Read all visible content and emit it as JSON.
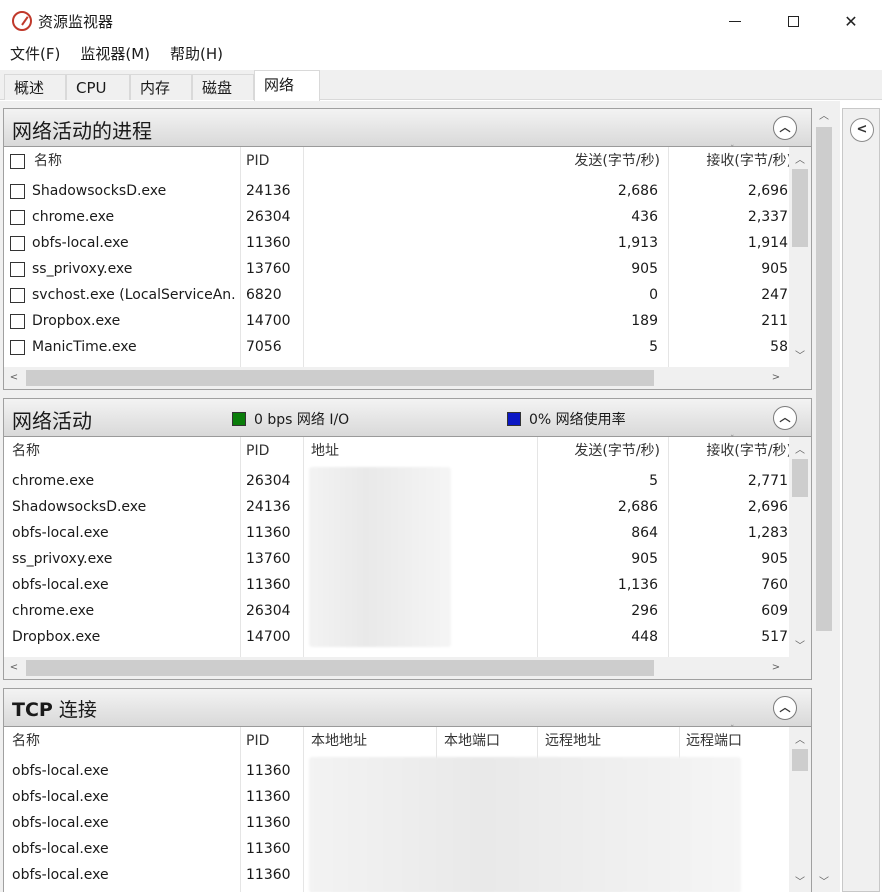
{
  "window": {
    "title": "资源监视器",
    "min": "—",
    "close": "✕"
  },
  "menu": [
    "文件(F)",
    "监视器(M)",
    "帮助(H)"
  ],
  "tabs": [
    "概述",
    "CPU",
    "内存",
    "磁盘",
    "网络"
  ],
  "activeTab": "网络",
  "sections": {
    "processes": {
      "title": "网络活动的进程",
      "columns": [
        "名称",
        "PID",
        "发送(字节/秒)",
        "接收(字节/秒)"
      ],
      "rows": [
        {
          "name": "ShadowsocksD.exe",
          "pid": "24136",
          "send": "2,686",
          "recv": "2,696"
        },
        {
          "name": "chrome.exe",
          "pid": "26304",
          "send": "436",
          "recv": "2,337"
        },
        {
          "name": "obfs-local.exe",
          "pid": "11360",
          "send": "1,913",
          "recv": "1,914"
        },
        {
          "name": "ss_privoxy.exe",
          "pid": "13760",
          "send": "905",
          "recv": "905"
        },
        {
          "name": "svchost.exe (LocalServiceAn...",
          "pid": "6820",
          "send": "0",
          "recv": "247"
        },
        {
          "name": "Dropbox.exe",
          "pid": "14700",
          "send": "189",
          "recv": "211"
        },
        {
          "name": "ManicTime.exe",
          "pid": "7056",
          "send": "5",
          "recv": "58"
        }
      ]
    },
    "activity": {
      "title": "网络活动",
      "legend_io": "0 bps 网络 I/O",
      "legend_usage": "0% 网络使用率",
      "io_color": "#0a7d0a",
      "usage_color": "#0b17c4",
      "columns": [
        "名称",
        "PID",
        "地址",
        "发送(字节/秒)",
        "接收(字节/秒)"
      ],
      "rows": [
        {
          "name": "chrome.exe",
          "pid": "26304",
          "send": "5",
          "recv": "2,771"
        },
        {
          "name": "ShadowsocksD.exe",
          "pid": "24136",
          "send": "2,686",
          "recv": "2,696"
        },
        {
          "name": "obfs-local.exe",
          "pid": "11360",
          "send": "864",
          "recv": "1,283"
        },
        {
          "name": "ss_privoxy.exe",
          "pid": "13760",
          "send": "905",
          "recv": "905"
        },
        {
          "name": "obfs-local.exe",
          "pid": "11360",
          "send": "1,136",
          "recv": "760"
        },
        {
          "name": "chrome.exe",
          "pid": "26304",
          "send": "296",
          "recv": "609"
        },
        {
          "name": "Dropbox.exe",
          "pid": "14700",
          "send": "448",
          "recv": "517"
        }
      ]
    },
    "tcp": {
      "title_bold": "TCP",
      "title_rest": " 连接",
      "columns": [
        "名称",
        "PID",
        "本地地址",
        "本地端口",
        "远程地址",
        "远程端口"
      ],
      "rows": [
        {
          "name": "obfs-local.exe",
          "pid": "11360"
        },
        {
          "name": "obfs-local.exe",
          "pid": "11360"
        },
        {
          "name": "obfs-local.exe",
          "pid": "11360"
        },
        {
          "name": "obfs-local.exe",
          "pid": "11360"
        },
        {
          "name": "obfs-local.exe",
          "pid": "11360"
        }
      ]
    }
  }
}
